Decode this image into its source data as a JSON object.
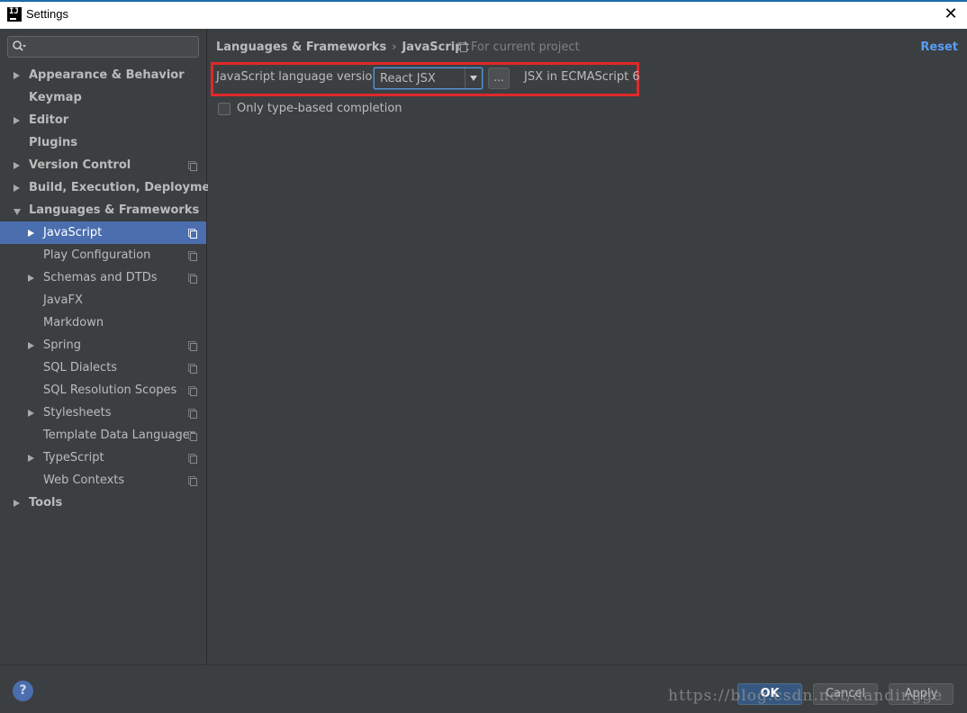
{
  "window": {
    "title": "Settings"
  },
  "search": {
    "placeholder": ""
  },
  "sidebar": {
    "items": [
      {
        "label": "Appearance & Behavior",
        "level": 0,
        "expandable": true,
        "expanded": false,
        "project": false,
        "selected": false,
        "icon": "chevron-right-icon"
      },
      {
        "label": "Keymap",
        "level": 0,
        "expandable": false,
        "project": false,
        "selected": false
      },
      {
        "label": "Editor",
        "level": 0,
        "expandable": true,
        "expanded": false,
        "project": false,
        "selected": false,
        "icon": "chevron-right-icon"
      },
      {
        "label": "Plugins",
        "level": 0,
        "expandable": false,
        "project": false,
        "selected": false
      },
      {
        "label": "Version Control",
        "level": 0,
        "expandable": true,
        "expanded": false,
        "project": true,
        "selected": false,
        "icon": "chevron-right-icon"
      },
      {
        "label": "Build, Execution, Deployment",
        "level": 0,
        "expandable": true,
        "expanded": false,
        "project": false,
        "selected": false,
        "icon": "chevron-right-icon"
      },
      {
        "label": "Languages & Frameworks",
        "level": 0,
        "expandable": true,
        "expanded": true,
        "project": false,
        "selected": false,
        "icon": "chevron-down-icon"
      },
      {
        "label": "JavaScript",
        "level": 1,
        "expandable": true,
        "expanded": false,
        "project": true,
        "selected": true,
        "icon": "chevron-right-icon"
      },
      {
        "label": "Play Configuration",
        "level": 1,
        "expandable": false,
        "project": true,
        "selected": false
      },
      {
        "label": "Schemas and DTDs",
        "level": 1,
        "expandable": true,
        "expanded": false,
        "project": true,
        "selected": false,
        "icon": "chevron-right-icon"
      },
      {
        "label": "JavaFX",
        "level": 1,
        "expandable": false,
        "project": false,
        "selected": false
      },
      {
        "label": "Markdown",
        "level": 1,
        "expandable": false,
        "project": false,
        "selected": false
      },
      {
        "label": "Spring",
        "level": 1,
        "expandable": true,
        "expanded": false,
        "project": true,
        "selected": false,
        "icon": "chevron-right-icon"
      },
      {
        "label": "SQL Dialects",
        "level": 1,
        "expandable": false,
        "project": true,
        "selected": false
      },
      {
        "label": "SQL Resolution Scopes",
        "level": 1,
        "expandable": false,
        "project": true,
        "selected": false
      },
      {
        "label": "Stylesheets",
        "level": 1,
        "expandable": true,
        "expanded": false,
        "project": true,
        "selected": false,
        "icon": "chevron-right-icon"
      },
      {
        "label": "Template Data Languages",
        "level": 1,
        "expandable": false,
        "project": true,
        "selected": false
      },
      {
        "label": "TypeScript",
        "level": 1,
        "expandable": true,
        "expanded": false,
        "project": true,
        "selected": false,
        "icon": "chevron-right-icon"
      },
      {
        "label": "Web Contexts",
        "level": 1,
        "expandable": false,
        "project": true,
        "selected": false
      },
      {
        "label": "Tools",
        "level": 0,
        "expandable": true,
        "expanded": false,
        "project": false,
        "selected": false,
        "icon": "chevron-right-icon"
      }
    ]
  },
  "breadcrumb": {
    "parent": "Languages & Frameworks",
    "separator": "›",
    "current": "JavaScript"
  },
  "scope": {
    "label": "For current project",
    "icon": "copy-icon"
  },
  "reset_label": "Reset",
  "settings": {
    "language_version_label": "JavaScript language version",
    "language_version_value": "React JSX",
    "ellipsis_label": "...",
    "language_version_description": "JSX in ECMAScript 6",
    "type_based_completion_label": "Only type-based completion",
    "type_based_completion_checked": false
  },
  "footer": {
    "help_label": "?",
    "ok_label": "OK",
    "cancel_label": "Cancel",
    "apply_label": "Apply",
    "watermark": "https://blog.csdn.net/dandingge"
  },
  "colors": {
    "accent": "#589df6",
    "selection": "#4b6eaf",
    "highlight_border": "#e0282a",
    "background": "#3c3f41"
  }
}
